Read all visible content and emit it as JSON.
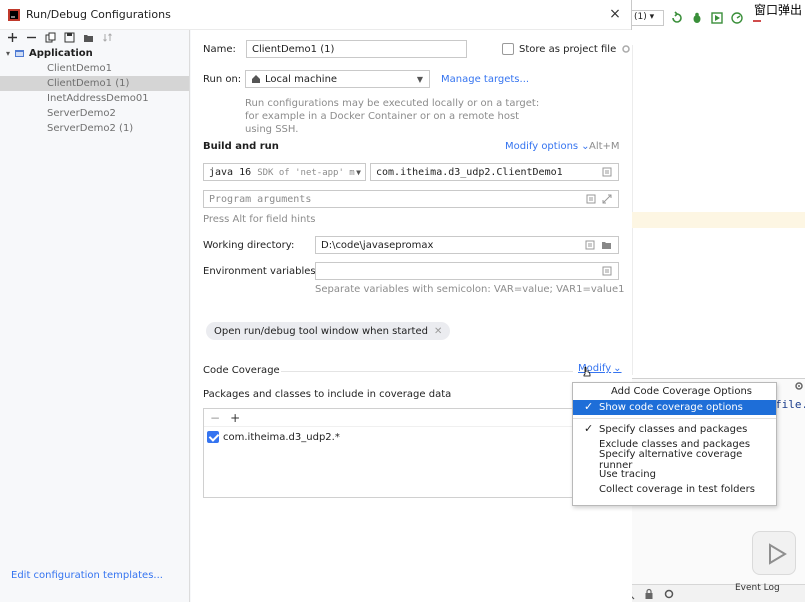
{
  "dialog": {
    "title": "Run/Debug Configurations",
    "close": "×"
  },
  "tree": {
    "root": "Application",
    "items": [
      "ClientDemo1",
      "ClientDemo1 (1)",
      "InetAddressDemo01",
      "ServerDemo2",
      "ServerDemo2 (1)"
    ],
    "selected_index": 1
  },
  "left_footer": {
    "edit_templates": "Edit configuration templates..."
  },
  "form": {
    "name_label": "Name:",
    "name_value": "ClientDemo1 (1)",
    "store_label": "Store as project file",
    "run_on_label": "Run on:",
    "run_on_value": "Local machine",
    "manage_targets": "Manage targets...",
    "run_hint": "Run configurations may be executed locally or on a target: for example in a Docker Container or on a remote host using SSH.",
    "build_run_title": "Build and run",
    "modify_options": "Modify options",
    "modify_shortcut": "Alt+M",
    "jdk_value": "java 16",
    "jdk_suffix": "SDK of 'net-app' m",
    "main_class": "com.itheima.d3_udp2.ClientDemo1",
    "program_args_placeholder": "Program arguments",
    "alt_hint": "Press Alt for field hints",
    "workdir_label": "Working directory:",
    "workdir_value": "D:\\code\\javasepromax",
    "env_label": "Environment variables:",
    "env_hint": "Separate variables with semicolon: VAR=value; VAR1=value1",
    "tag_chip": "Open run/debug tool window when started",
    "coverage_label": "Code Coverage",
    "coverage_modify": "Modify",
    "packages_label": "Packages and classes to include in coverage data",
    "package_entry": "com.itheima.d3_udp2.*"
  },
  "popup": {
    "header": "Add Code Coverage Options",
    "items": [
      {
        "label": "Show code coverage options",
        "checked": true,
        "highlighted": true
      },
      {
        "label": "Specify classes and packages",
        "checked": true,
        "highlighted": false
      },
      {
        "label": "Exclude classes and packages",
        "checked": false,
        "highlighted": false
      },
      {
        "label": "Specify alternative coverage runner",
        "checked": false,
        "highlighted": false
      },
      {
        "label": "Use tracing",
        "checked": false,
        "highlighted": false
      },
      {
        "label": "Collect coverage in test folders",
        "checked": false,
        "highlighted": false
      }
    ]
  },
  "ide": {
    "config_combo": "(1)",
    "panel_text": "file.",
    "status_log": "Event Log",
    "overlay_text": "窗口弹出"
  },
  "colors": {
    "accent": "#3574f0",
    "highlight": "#1e6ed8",
    "selection": "#d5d5d5"
  }
}
